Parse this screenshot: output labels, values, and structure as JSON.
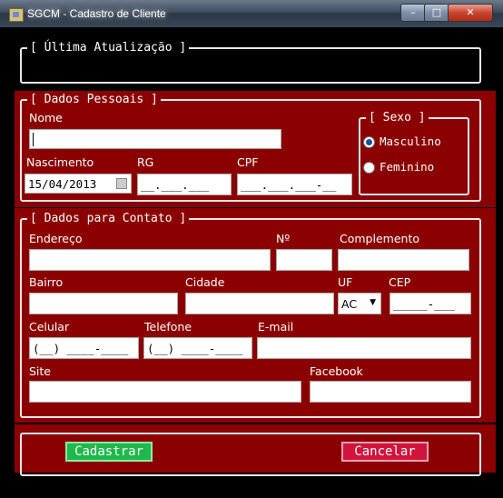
{
  "window": {
    "title": "SGCM - Cadastro de Cliente",
    "min_glyph": "–",
    "max_glyph": "□",
    "close_glyph": "✕"
  },
  "groups": {
    "last_update": "[ Última Atualização ]",
    "personal": "[ Dados Pessoais ]",
    "sex": "[ Sexo ]",
    "contact": "[ Dados para Contato ]"
  },
  "personal": {
    "name_label": "Nome",
    "name_value": "",
    "birth_label": "Nascimento",
    "birth_value": "15/04/2013",
    "rg_label": "RG",
    "rg_mask": "__.___.___",
    "cpf_label": "CPF",
    "cpf_mask": "___.___.___-__"
  },
  "sex": {
    "options": [
      {
        "label": "Masculino",
        "checked": true
      },
      {
        "label": "Feminino",
        "checked": false
      }
    ]
  },
  "contact": {
    "address_label": "Endereço",
    "number_label": "Nº",
    "complement_label": "Complemento",
    "district_label": "Bairro",
    "city_label": "Cidade",
    "uf_label": "UF",
    "uf_value": "AC",
    "cep_label": "CEP",
    "cep_mask": "_____-___",
    "mobile_label": "Celular",
    "mobile_mask": "(__) ____-____",
    "phone_label": "Telefone",
    "phone_mask": "(__) ____-____",
    "email_label": "E-mail",
    "site_label": "Site",
    "facebook_label": "Facebook"
  },
  "actions": {
    "register": "Cadastrar",
    "cancel": "Cancelar"
  },
  "colors": {
    "panel": "#8b0000",
    "register": "#1fb84a",
    "cancel": "#d0143c"
  }
}
